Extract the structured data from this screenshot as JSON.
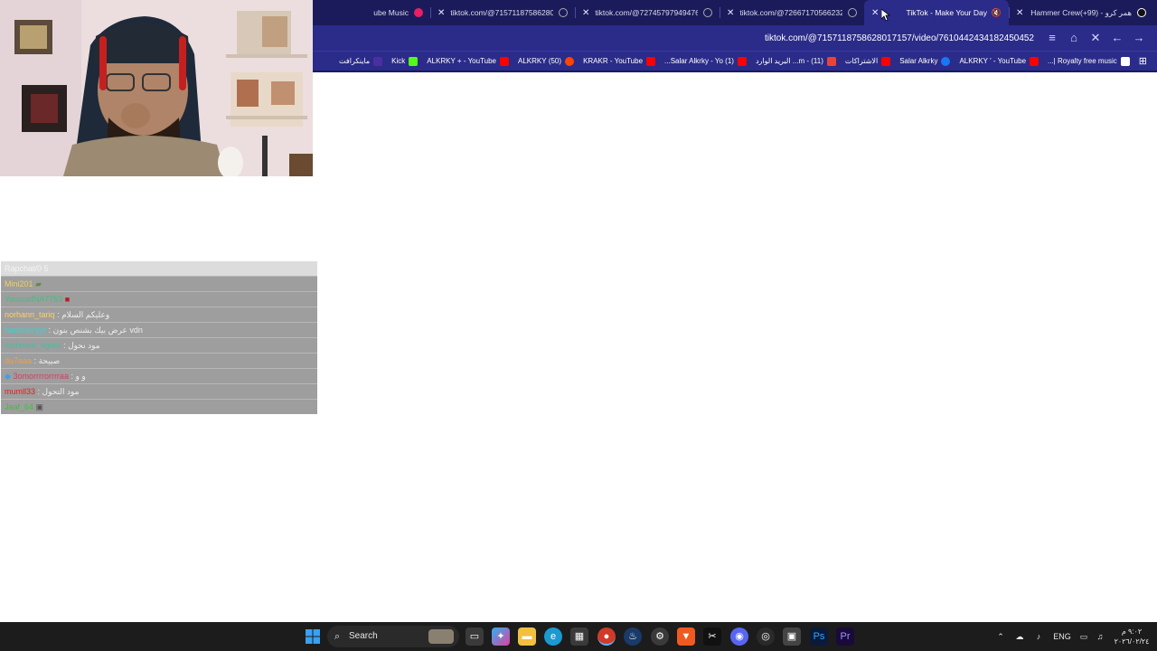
{
  "tabs": [
    {
      "title": "Hammer Crew(+99) - همر كرو",
      "favicon_color": "#111111",
      "active": false
    },
    {
      "title": "TikTok - Make Your Day",
      "favicon_color": "#2b2b8a",
      "active": true
    },
    {
      "title": "tiktok.com/@72667170566232",
      "favicon_color": "#888888",
      "active": false
    },
    {
      "title": "tiktok.com/@72745797949476",
      "favicon_color": "#888888",
      "active": false
    },
    {
      "title": "tiktok.com/@71571187586280",
      "favicon_color": "#888888",
      "active": false
    },
    {
      "title": "ube Music",
      "favicon_color": "#e91e63",
      "active": false
    }
  ],
  "toolbar": {
    "address": "tiktok.com/@715711875862801715​7/video/7610442434182450452",
    "reload_icon": "close-icon",
    "home_icon": "home-icon",
    "settings_icon": "sliders-icon"
  },
  "bookmarks": [
    {
      "label": "Royalty free music |...",
      "icon_color": "#ffffff"
    },
    {
      "label": "ALKRKY ' - YouTube",
      "icon_color": "#ff0000"
    },
    {
      "label": "Salar Alkrky",
      "icon_color": "#1877f2"
    },
    {
      "label": "الاشتراكات",
      "icon_color": "#ff0000"
    },
    {
      "label": "(11) - m... البريد الوارد",
      "icon_color": "#ea4335"
    },
    {
      "label": "(1) Salar Alkrky - Yo...",
      "icon_color": "#ff0000"
    },
    {
      "label": "KRAKR - YouTube",
      "icon_color": "#ff0000"
    },
    {
      "label": "(50) ALKRKY",
      "icon_color": "#ff4500"
    },
    {
      "label": "ALKRKY + - YouTube",
      "icon_color": "#53fc18"
    },
    {
      "label": "Kick",
      "icon_color": "#53fc18"
    },
    {
      "label": "ماينكرافت",
      "icon_color": "#4b2fa0"
    }
  ],
  "chat": {
    "header": "Rapchat/0 5",
    "messages": [
      {
        "user": "Mini201",
        "msg": "",
        "user_color": "#f0d060"
      },
      {
        "user": "YoussefNA7753",
        "msg": "",
        "user_color": "#40c080"
      },
      {
        "user": "norhann_tariq",
        "msg": ": وعليكم السلام",
        "user_color": "#ffd060"
      },
      {
        "user": "hasonnnyyt",
        "msg": ": عرض بيك بشنص بنون vdn",
        "user_color": "#40d0d0"
      },
      {
        "user": "mohmed_tigher",
        "msg": ": مود نحول",
        "user_color": "#40c0a0"
      },
      {
        "user": "du7aaa",
        "msg": ": صبيحة",
        "user_color": "#f0a040"
      },
      {
        "user": "3omorrrrorrrraa",
        "msg": ": و و",
        "user_color": "#d04060"
      },
      {
        "user": "mumll33",
        "msg": ": مود التحول",
        "user_color": "#e02020"
      },
      {
        "user": "Jaaf_64",
        "msg": "",
        "user_color": "#40c040"
      }
    ]
  },
  "taskbar": {
    "search_label": "Search",
    "lang": "ENG",
    "clock_time": "٩:٠٢ م",
    "clock_date": "٢٠٢٦/٠٢/٢٤"
  }
}
